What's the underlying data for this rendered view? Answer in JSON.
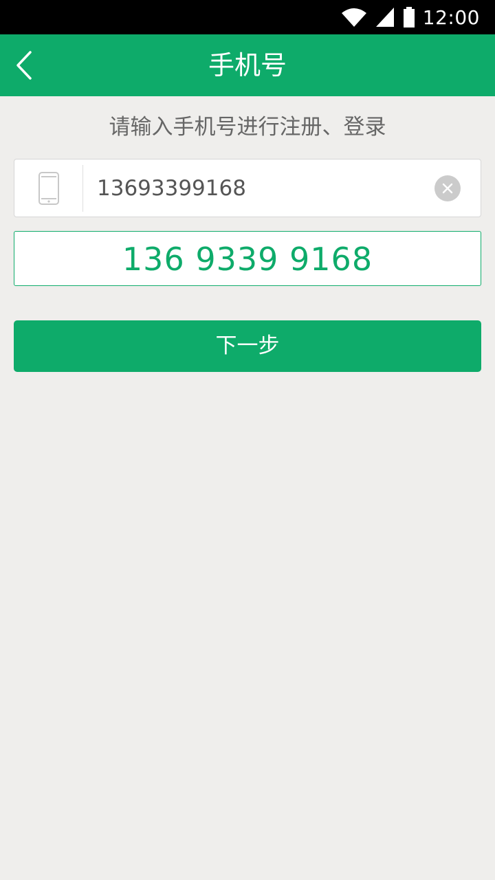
{
  "status_bar": {
    "time": "12:00",
    "icons": [
      "wifi-icon",
      "signal-icon",
      "battery-icon"
    ]
  },
  "app_bar": {
    "title": "手机号",
    "back_icon": "chevron-left-icon"
  },
  "form": {
    "instruction": "请输入手机号进行注册、登录",
    "phone_value": "13693399168",
    "phone_icon": "mobile-phone-icon",
    "clear_icon": "clear-icon",
    "formatted_number": "136 9339 9168",
    "next_label": "下一步"
  },
  "colors": {
    "primary": "#0eab6a",
    "background": "#efeeec",
    "status_bar": "#000000",
    "text_secondary": "#666666"
  }
}
